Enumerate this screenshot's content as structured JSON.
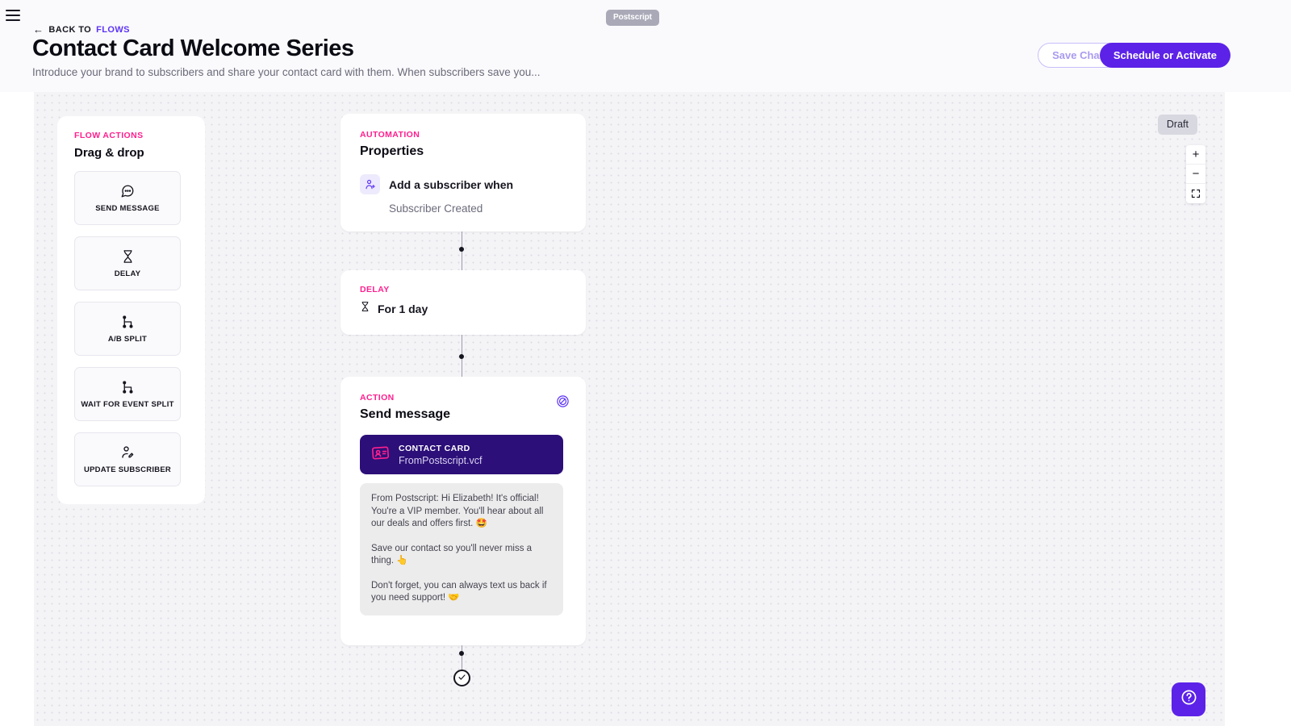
{
  "header": {
    "menu_icon": "hamburger-icon",
    "back_arrow": "←",
    "back_prefix": "BACK TO",
    "back_target": "FLOWS",
    "title": "Contact Card Welcome Series",
    "subtitle": "Introduce your brand to subscribers and share your contact card with them. When subscribers save you...",
    "brand": "Postscript",
    "save_label": "Save Changes",
    "activate_label": "Schedule or Activate",
    "accent_purple": "#5c22e8",
    "accent_pink": "#ff1f8e"
  },
  "palette": {
    "eyebrow": "FLOW ACTIONS",
    "title": "Drag & drop",
    "items": [
      {
        "label": "SEND MESSAGE",
        "icon": "message-bubble-icon"
      },
      {
        "label": "DELAY",
        "icon": "hourglass-icon"
      },
      {
        "label": "A/B SPLIT",
        "icon": "split-branch-icon"
      },
      {
        "label": "WAIT FOR EVENT SPLIT",
        "icon": "split-branch-icon"
      },
      {
        "label": "UPDATE SUBSCRIBER",
        "icon": "edit-person-icon"
      }
    ]
  },
  "flow": {
    "automation": {
      "eyebrow": "AUTOMATION",
      "title": "Properties",
      "trigger_icon": "add-person-icon",
      "trigger_label": "Add a subscriber when",
      "trigger_value": "Subscriber Created"
    },
    "delay": {
      "eyebrow": "DELAY",
      "icon": "hourglass-icon",
      "text": "For 1 day"
    },
    "action": {
      "eyebrow": "ACTION",
      "title": "Send message",
      "badge_icon": "no-discount-icon",
      "attachment": {
        "icon": "contact-card-icon",
        "kicker": "CONTACT CARD",
        "filename": "FromPostscript.vcf",
        "background": "#2c0f78"
      },
      "message_paragraphs": [
        "From Postscript: Hi Elizabeth! It's official! You're a VIP member. You'll hear about all our deals and offers first. 🤩",
        "Save our contact so you'll never miss a thing. 👆",
        "Don't forget, you can always text us back if you need support! 🤝"
      ]
    },
    "end_icon": "check-circle-icon"
  },
  "canvas": {
    "status": "Draft",
    "zoom_in": "+",
    "zoom_out": "−",
    "fit_icon": "fit-screen-icon",
    "help_icon": "help-circle-icon"
  }
}
